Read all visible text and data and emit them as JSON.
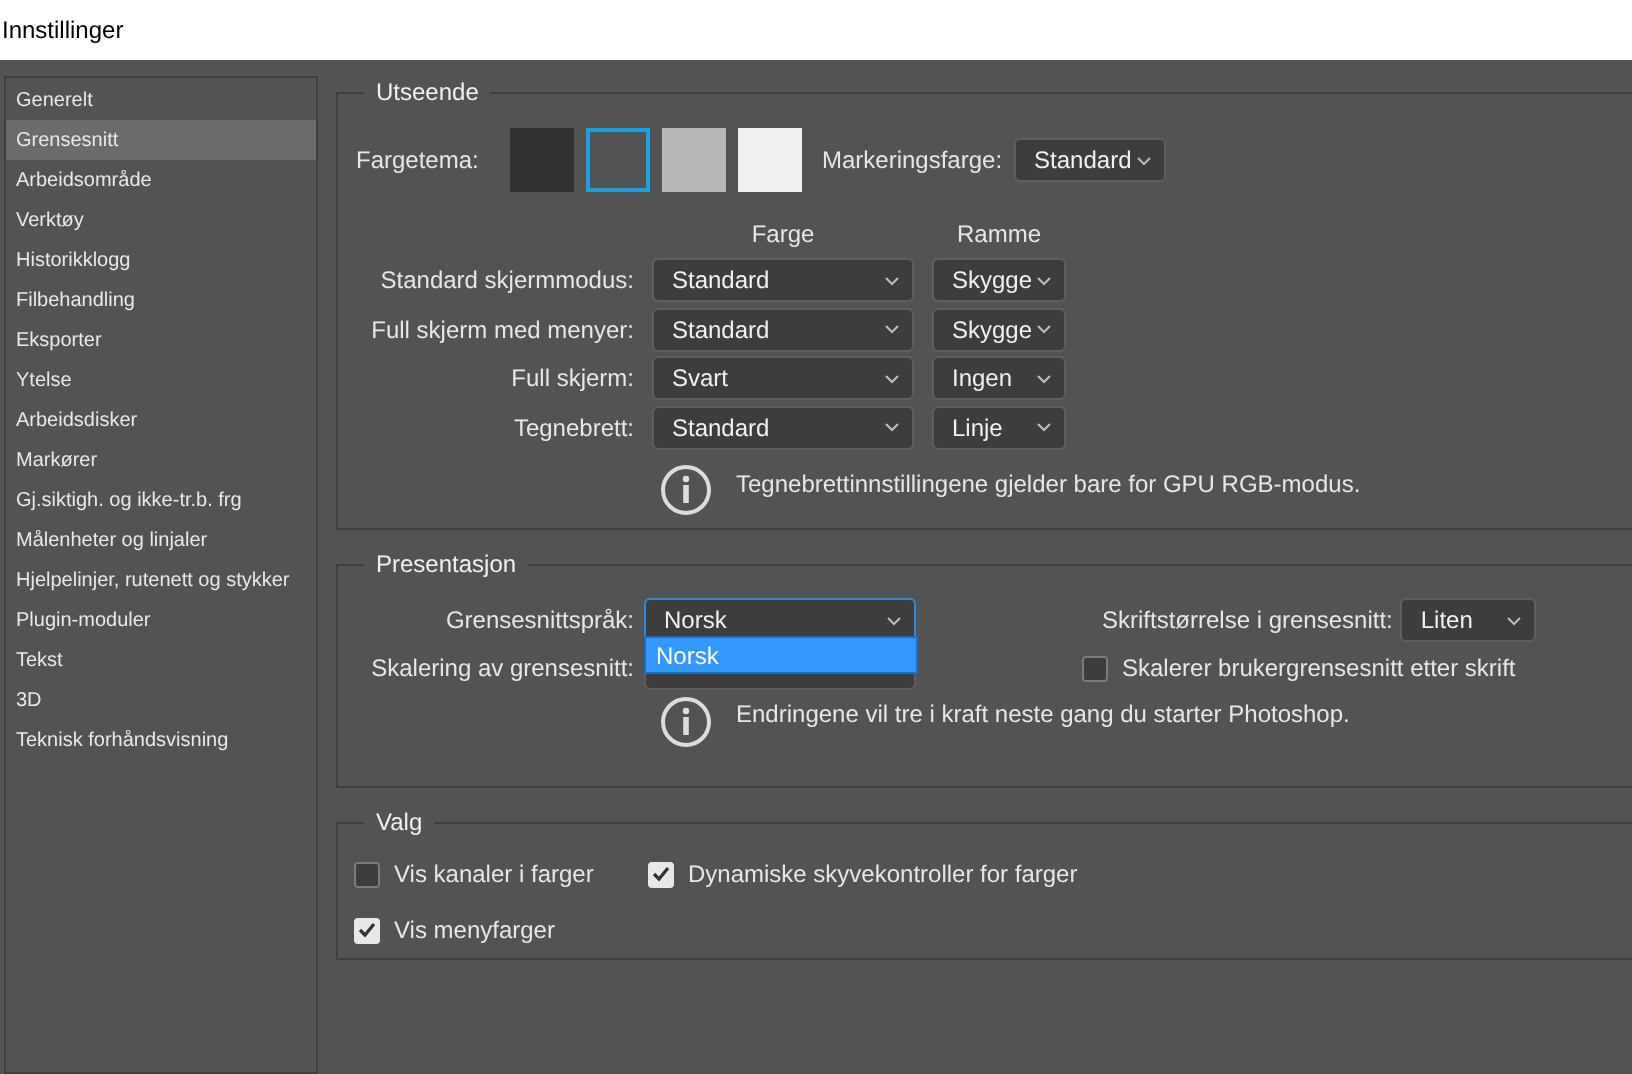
{
  "window": {
    "title": "Innstillinger"
  },
  "sidebar": {
    "items": [
      {
        "label": "Generelt",
        "selected": false
      },
      {
        "label": "Grensesnitt",
        "selected": true
      },
      {
        "label": "Arbeidsområde",
        "selected": false
      },
      {
        "label": "Verktøy",
        "selected": false
      },
      {
        "label": "Historikklogg",
        "selected": false
      },
      {
        "label": "Filbehandling",
        "selected": false
      },
      {
        "label": "Eksporter",
        "selected": false
      },
      {
        "label": "Ytelse",
        "selected": false
      },
      {
        "label": "Arbeidsdisker",
        "selected": false
      },
      {
        "label": "Markører",
        "selected": false
      },
      {
        "label": "Gj.siktigh. og ikke-tr.b. frg",
        "selected": false
      },
      {
        "label": "Målenheter og linjaler",
        "selected": false
      },
      {
        "label": "Hjelpelinjer, rutenett og stykker",
        "selected": false
      },
      {
        "label": "Plugin-moduler",
        "selected": false
      },
      {
        "label": "Tekst",
        "selected": false
      },
      {
        "label": "3D",
        "selected": false
      },
      {
        "label": "Teknisk forhåndsvisning",
        "selected": false
      }
    ]
  },
  "appearance": {
    "title": "Utseende",
    "color_theme": {
      "label": "Fargetema:",
      "swatches": [
        {
          "color": "#323232",
          "selected": false
        },
        {
          "color": "#535353",
          "selected": true
        },
        {
          "color": "#b8b8b8",
          "selected": false
        },
        {
          "color": "#f0f0f0",
          "selected": false
        }
      ]
    },
    "highlight_color": {
      "label": "Markeringsfarge:",
      "value": "Standard"
    },
    "columns": [
      "Farge",
      "Ramme"
    ],
    "rows": [
      {
        "label": "Standard skjermmodus:",
        "fill": "Standard",
        "frame": "Skygge"
      },
      {
        "label": "Full skjerm med menyer:",
        "fill": "Standard",
        "frame": "Skygge"
      },
      {
        "label": "Full skjerm:",
        "fill": "Svart",
        "frame": "Ingen"
      },
      {
        "label": "Tegnebrett:",
        "fill": "Standard",
        "frame": "Linje"
      }
    ],
    "note": "Tegnebrettinnstillingene gjelder bare for GPU RGB-modus."
  },
  "presentation": {
    "title": "Presentasjon",
    "language": {
      "label": "Grensesnittspråk:",
      "value": "Norsk",
      "open": true,
      "options": [
        {
          "label": "Norsk",
          "selected": true
        }
      ]
    },
    "scaling": {
      "label": "Skalering av grensesnitt:"
    },
    "font_size": {
      "label": "Skriftstørrelse i grensesnitt:",
      "value": "Liten"
    },
    "scale_with_font": {
      "label": "Skalerer brukergrensesnitt etter skrift",
      "checked": false
    },
    "note": "Endringene vil tre i kraft neste gang du starter Photoshop."
  },
  "options": {
    "title": "Valg",
    "checkboxes": [
      {
        "label": "Vis kanaler i farger",
        "checked": false
      },
      {
        "label": "Dynamiske skyvekontroller for farger",
        "checked": true
      },
      {
        "label": "Vis menyfarger",
        "checked": true
      }
    ]
  }
}
